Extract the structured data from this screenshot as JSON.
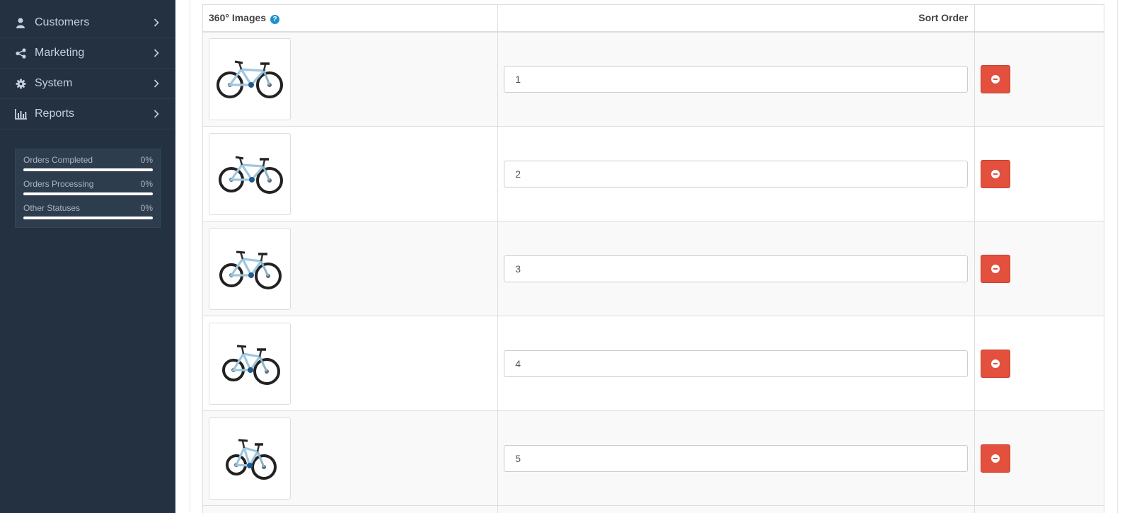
{
  "sidebar": {
    "items": [
      {
        "label": "Customers",
        "icon": "user-icon"
      },
      {
        "label": "Marketing",
        "icon": "share-icon"
      },
      {
        "label": "System",
        "icon": "gear-icon"
      },
      {
        "label": "Reports",
        "icon": "bar-chart-icon"
      }
    ],
    "stats": [
      {
        "label": "Orders Completed",
        "value": "0%"
      },
      {
        "label": "Orders Processing",
        "value": "0%"
      },
      {
        "label": "Other Statuses",
        "value": "0%"
      }
    ]
  },
  "table": {
    "headers": {
      "images": "360° Images",
      "help": "?",
      "sort_order": "Sort Order"
    },
    "rows": [
      {
        "sort_order": "1"
      },
      {
        "sort_order": "2"
      },
      {
        "sort_order": "3"
      },
      {
        "sort_order": "4"
      },
      {
        "sort_order": "5"
      }
    ]
  },
  "colors": {
    "sidebar_bg": "#243140",
    "danger": "#e3503e",
    "help": "#1e91cf"
  }
}
